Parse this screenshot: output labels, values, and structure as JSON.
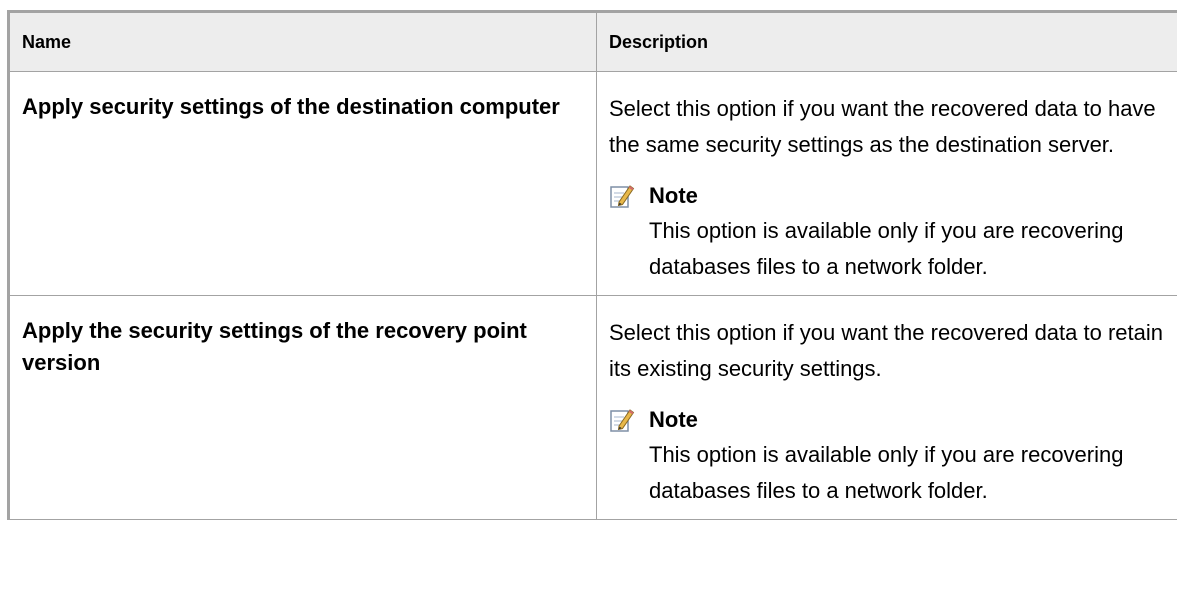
{
  "table": {
    "headers": {
      "name": "Name",
      "description": "Description"
    },
    "rows": [
      {
        "name": "Apply security settings of the destination computer",
        "description": "Select this option if you want the recovered data to have the same security settings as the destination server.",
        "note_label": "Note",
        "note_text": "This option is available only if you are recovering databases files to a network folder."
      },
      {
        "name": "Apply the security settings of the recovery point version",
        "description": "Select this option if you want the recovered data to retain its existing security settings.",
        "note_label": "Note",
        "note_text": "This option is available only if you are recovering databases files to a network folder."
      }
    ]
  },
  "icons": {
    "note": "note-pencil-icon"
  }
}
